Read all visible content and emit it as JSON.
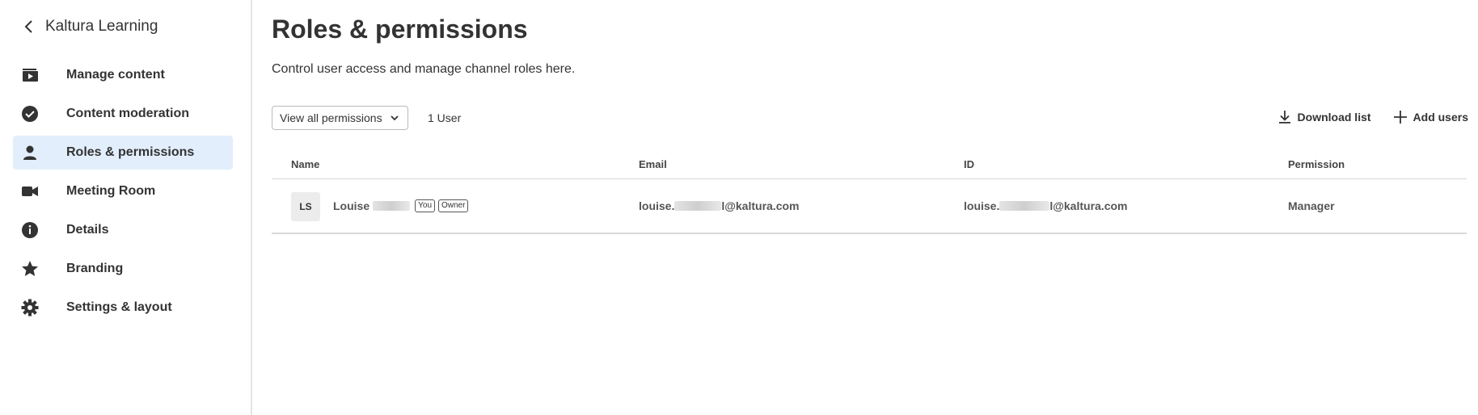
{
  "sidebar": {
    "back_title": "Kaltura Learning",
    "items": [
      {
        "label": "Manage content",
        "icon": "play-icon"
      },
      {
        "label": "Content moderation",
        "icon": "check-circle-icon"
      },
      {
        "label": "Roles & permissions",
        "icon": "person-icon",
        "active": true
      },
      {
        "label": "Meeting Room",
        "icon": "video-camera-icon"
      },
      {
        "label": "Details",
        "icon": "info-icon"
      },
      {
        "label": "Branding",
        "icon": "star-icon"
      },
      {
        "label": "Settings & layout",
        "icon": "gear-icon"
      }
    ]
  },
  "main": {
    "title": "Roles & permissions",
    "subtitle": "Control user access and manage channel roles here.",
    "filter": {
      "selected": "View all permissions"
    },
    "user_count": "1 User",
    "actions": {
      "download_label": "Download list",
      "add_label": "Add users"
    }
  },
  "table": {
    "headers": {
      "name": "Name",
      "email": "Email",
      "id": "ID",
      "permission": "Permission"
    },
    "rows": [
      {
        "initials": "LS",
        "name": "Louise",
        "tags": [
          "You",
          "Owner"
        ],
        "email_prefix": "louise.",
        "email_suffix": "l@kaltura.com",
        "id_prefix": "louise.",
        "id_suffix": "l@kaltura.com",
        "permission": "Manager"
      }
    ]
  },
  "colors": {
    "active_bg": "#e2eefb",
    "text": "#333333",
    "border": "#d8d8d8"
  }
}
